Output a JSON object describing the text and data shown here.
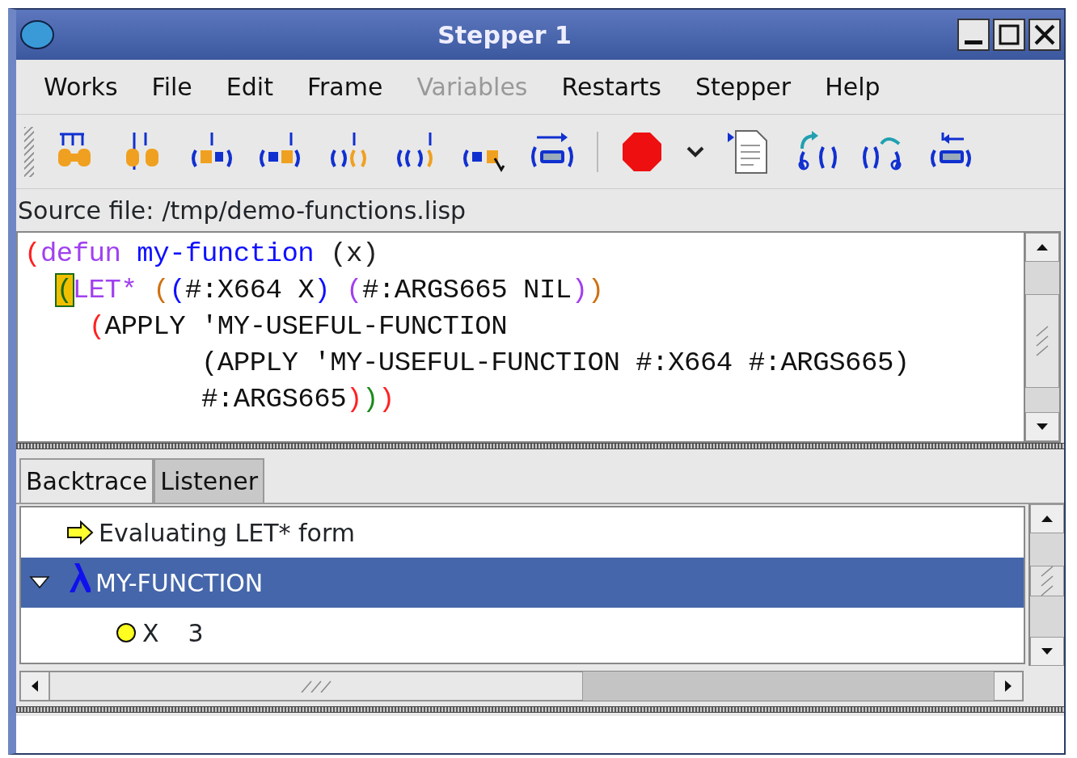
{
  "window": {
    "title": "Stepper 1"
  },
  "menu": [
    {
      "label": "Works",
      "disabled": false
    },
    {
      "label": "File",
      "disabled": false
    },
    {
      "label": "Edit",
      "disabled": false
    },
    {
      "label": "Frame",
      "disabled": false
    },
    {
      "label": "Variables",
      "disabled": true
    },
    {
      "label": "Restarts",
      "disabled": false
    },
    {
      "label": "Stepper",
      "disabled": false
    },
    {
      "label": "Help",
      "disabled": false
    }
  ],
  "source_file": {
    "label": "Source file:",
    "path": "/tmp/demo-functions.lisp"
  },
  "code_lines": [
    [
      {
        "text": "(",
        "color": "#ff2020"
      },
      {
        "text": "defun ",
        "color": "#a040f0"
      },
      {
        "text": "my-function ",
        "color": "#1010ff"
      },
      {
        "text": "(x)",
        "color": "#202020"
      }
    ],
    [
      {
        "text": "  (",
        "cursor": true
      },
      {
        "text": "LET* ",
        "color": "#a040f0"
      },
      {
        "text": "(",
        "color": "#d07010"
      },
      {
        "text": "(",
        "color": "#1010ff"
      },
      {
        "text": "#:X664 X",
        "color": "#111111"
      },
      {
        "text": ") ",
        "color": "#1010ff"
      },
      {
        "text": "(",
        "color": "#a040f0"
      },
      {
        "text": "#:ARGS665 NIL",
        "color": "#111111"
      },
      {
        "text": ")",
        "color": "#a040f0"
      },
      {
        "text": ")",
        "color": "#d07010"
      }
    ],
    [
      {
        "text": "    (",
        "color": "#ff2020"
      },
      {
        "text": "APPLY 'MY-USEFUL-FUNCTION",
        "color": "#111111"
      }
    ],
    [
      {
        "text": "           (APPLY 'MY-USEFUL-FUNCTION #:X664 #:ARGS665)",
        "color": "#111111"
      }
    ],
    [
      {
        "text": "           #:ARGS665",
        "color": "#111111"
      },
      {
        "text": ")",
        "color": "#ff2020"
      },
      {
        "text": ")",
        "color": "#1a8a1a"
      },
      {
        "text": ")",
        "color": "#ff2020"
      }
    ]
  ],
  "tabs": [
    {
      "label": "Backtrace",
      "selected": true
    },
    {
      "label": "Listener",
      "selected": false
    }
  ],
  "backtrace": [
    {
      "kind": "step",
      "text": "Evaluating LET* form",
      "selected": false
    },
    {
      "kind": "function",
      "text": "MY-FUNCTION",
      "selected": true,
      "expanded": true,
      "children": [
        {
          "kind": "variable",
          "name": "X",
          "value": "3"
        }
      ]
    }
  ]
}
